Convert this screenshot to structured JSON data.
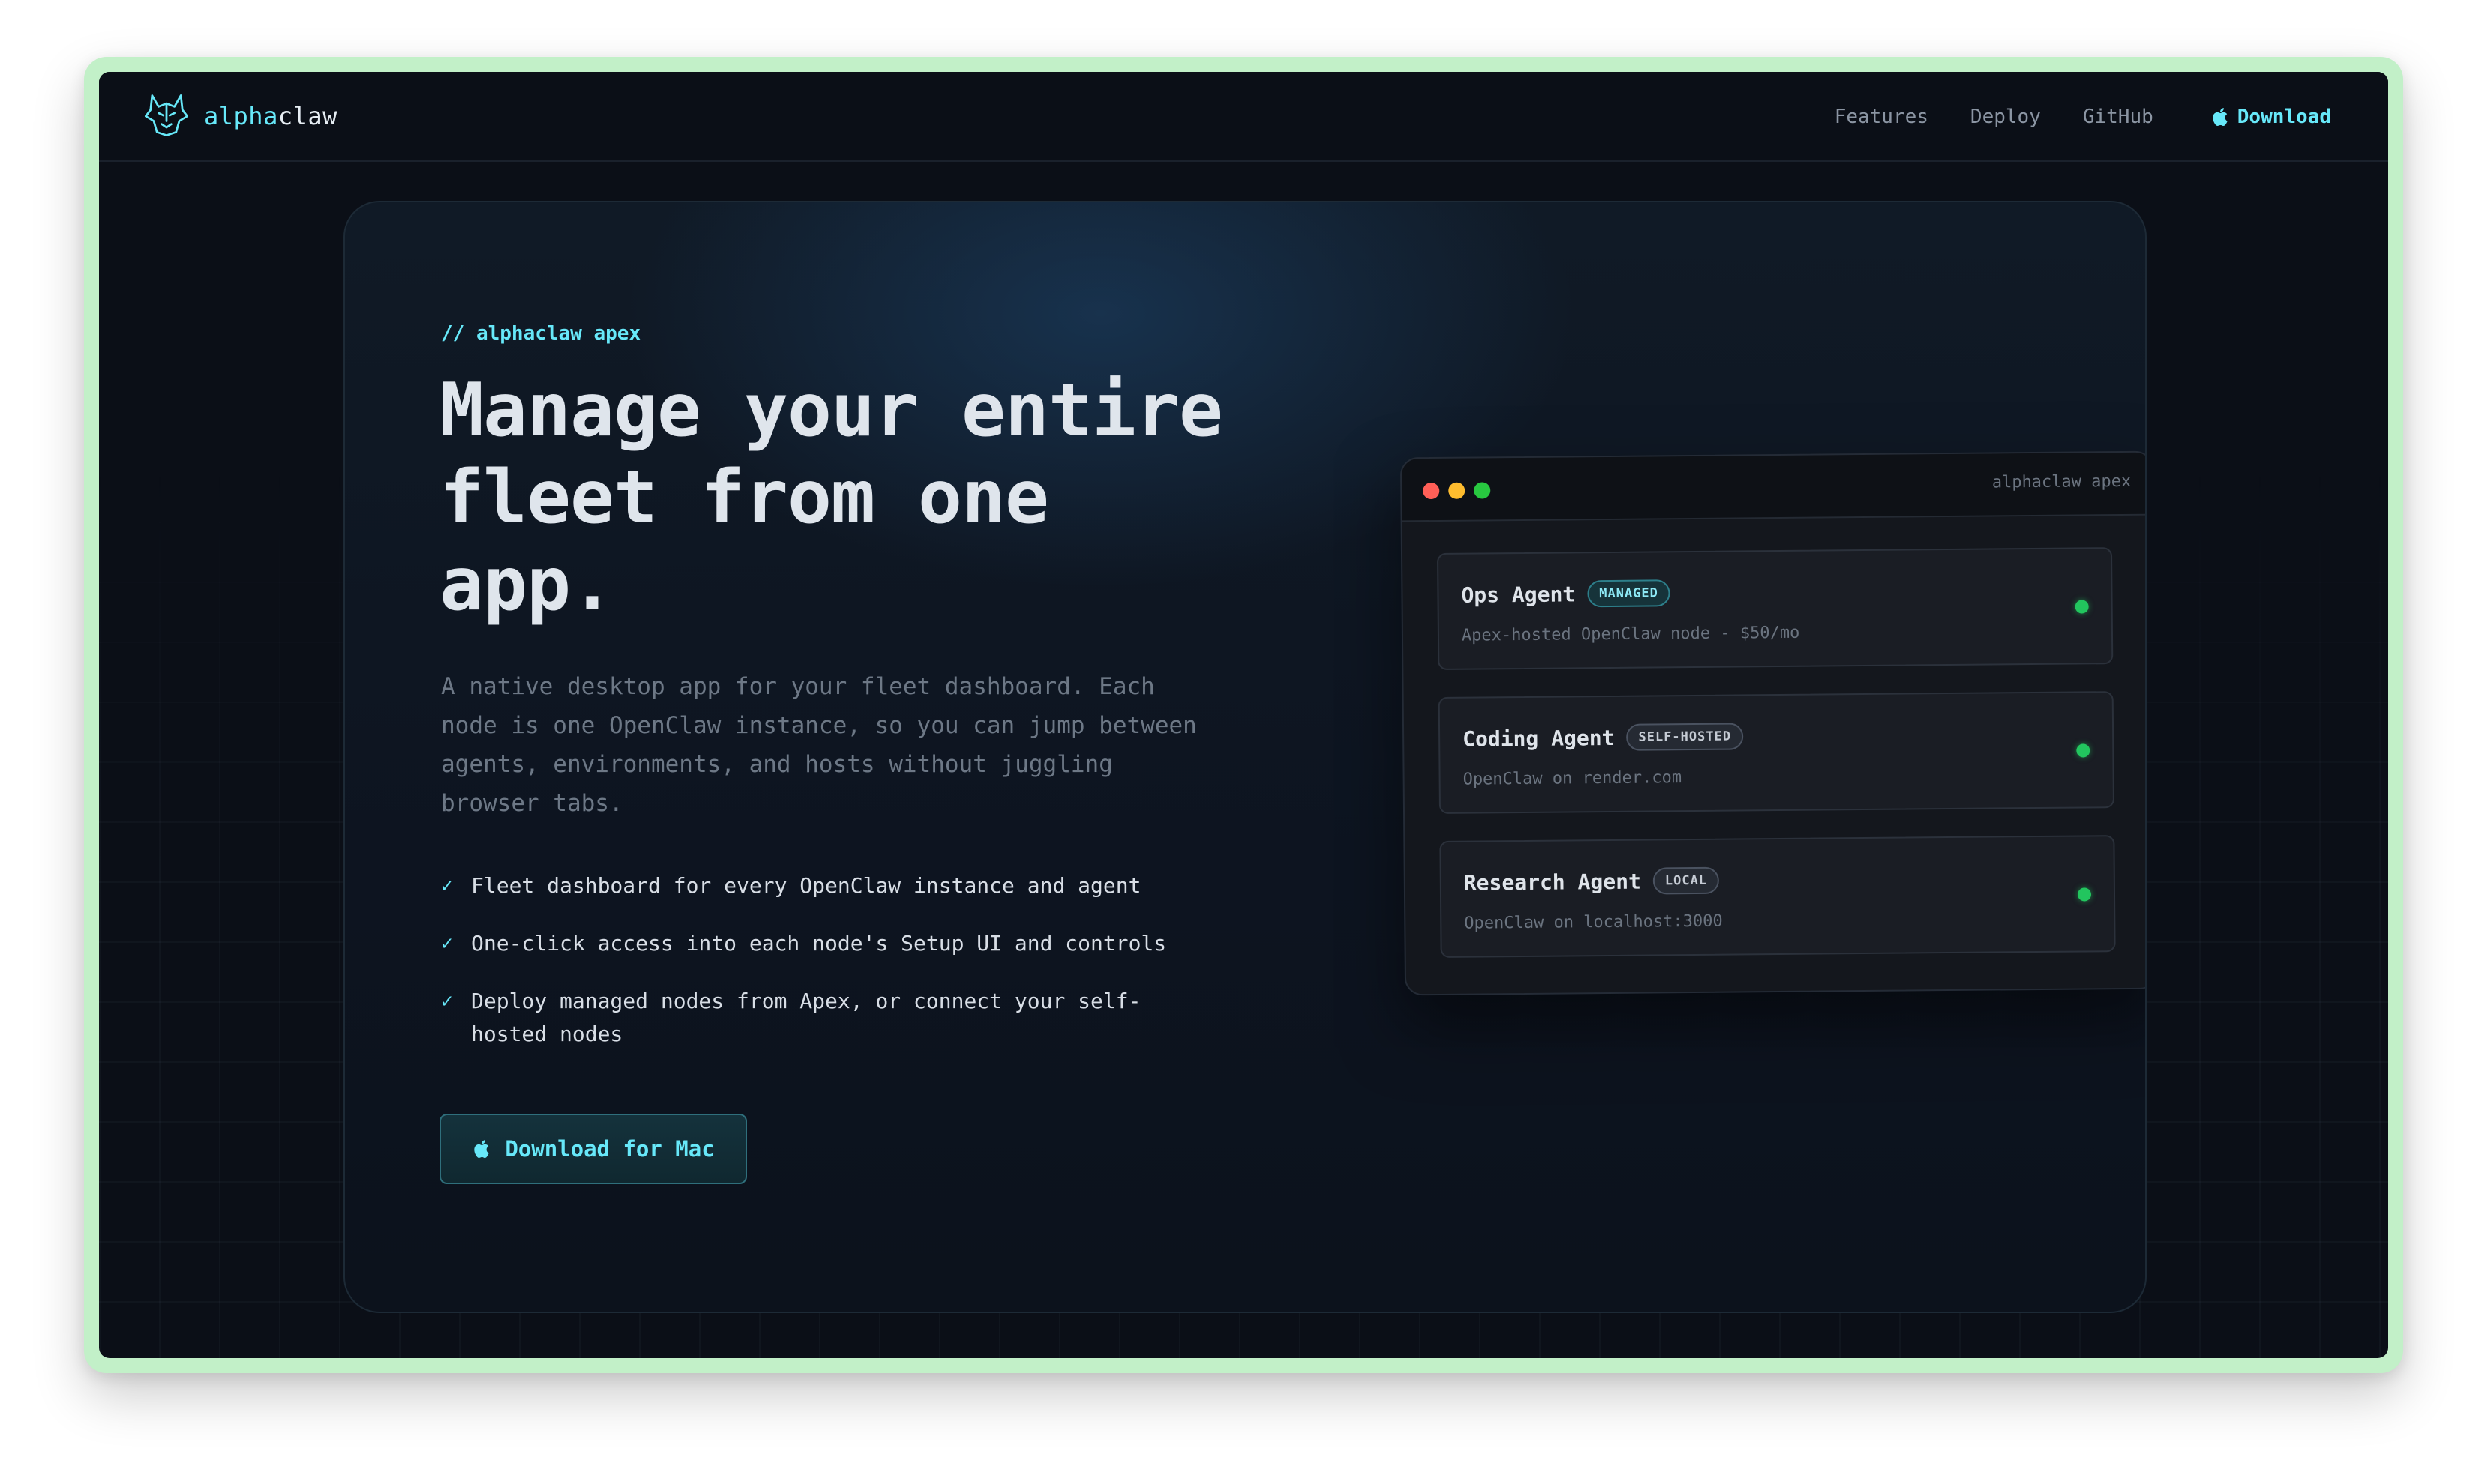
{
  "brand": {
    "name_accent": "alpha",
    "name_rest": "claw",
    "logo_icon": "wolf-head-icon"
  },
  "nav": {
    "links": [
      "Features",
      "Deploy",
      "GitHub"
    ],
    "download_label": "Download",
    "download_icon": "apple-icon"
  },
  "hero": {
    "eyebrow": "// alphaclaw apex",
    "headline": "Manage your entire fleet from one app.",
    "lead": "A native desktop app for your fleet dashboard. Each node is one OpenClaw instance, so you can jump between agents, environments, and hosts without juggling browser tabs.",
    "features": [
      "Fleet dashboard for every OpenClaw instance and agent",
      "One-click access into each node's Setup UI and controls",
      "Deploy managed nodes from Apex, or connect your self-hosted nodes"
    ],
    "check_glyph": "✓",
    "cta_label": "Download for Mac"
  },
  "mock": {
    "title": "alphaclaw apex",
    "agents": [
      {
        "name": "Ops Agent",
        "badge": "MANAGED",
        "subtitle": "Apex-hosted OpenClaw node - $50/mo",
        "status": "online"
      },
      {
        "name": "Coding Agent",
        "badge": "SELF-HOSTED",
        "subtitle": "OpenClaw on render.com",
        "status": "online"
      },
      {
        "name": "Research Agent",
        "badge": "LOCAL",
        "subtitle": "OpenClaw on localhost:3000",
        "status": "online"
      }
    ]
  },
  "colors": {
    "accent": "#67e8f9",
    "background": "#0b0f17",
    "status_online": "#22c55e",
    "frame": "#c2f0c8"
  }
}
